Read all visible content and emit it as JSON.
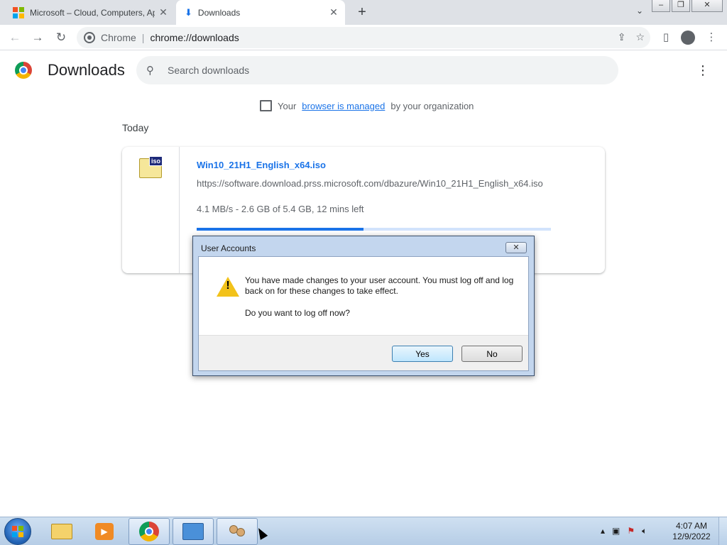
{
  "browser": {
    "tabs": [
      {
        "title": "Microsoft – Cloud, Computers, Ap",
        "icon": "microsoft-logo-icon",
        "active": false
      },
      {
        "title": "Downloads",
        "icon": "download-icon",
        "active": true
      }
    ],
    "omnibox": {
      "scheme_label": "Chrome",
      "url": "chrome://downloads"
    }
  },
  "page": {
    "title": "Downloads",
    "search_placeholder": "Search downloads",
    "managed_prefix": "Your",
    "managed_link": "browser is managed",
    "managed_suffix": "by your organization",
    "section": "Today"
  },
  "download": {
    "file_name": "Win10_21H1_English_x64.iso",
    "url": "https://software.download.prss.microsoft.com/dbazure/Win10_21H1_English_x64.iso",
    "status": "4.1 MB/s - 2.6 GB of 5.4 GB, 12 mins left",
    "progress_fraction": 0.47,
    "icon_label": "iso"
  },
  "dialog": {
    "title": "User Accounts",
    "message": "You have made changes to your user account. You must log off and log back on for these changes to take effect.",
    "question": "Do you want to log off now?",
    "yes_label": "Yes",
    "no_label": "No"
  },
  "taskbar": {
    "time": "4:07 AM",
    "date": "12/9/2022",
    "apps": [
      "windows-explorer",
      "windows-media-player",
      "google-chrome",
      "control-panel",
      "user-accounts"
    ]
  },
  "colors": {
    "accent": "#1a73e8",
    "progress_track": "#d2e3fc",
    "warning": "#f2c21a"
  }
}
